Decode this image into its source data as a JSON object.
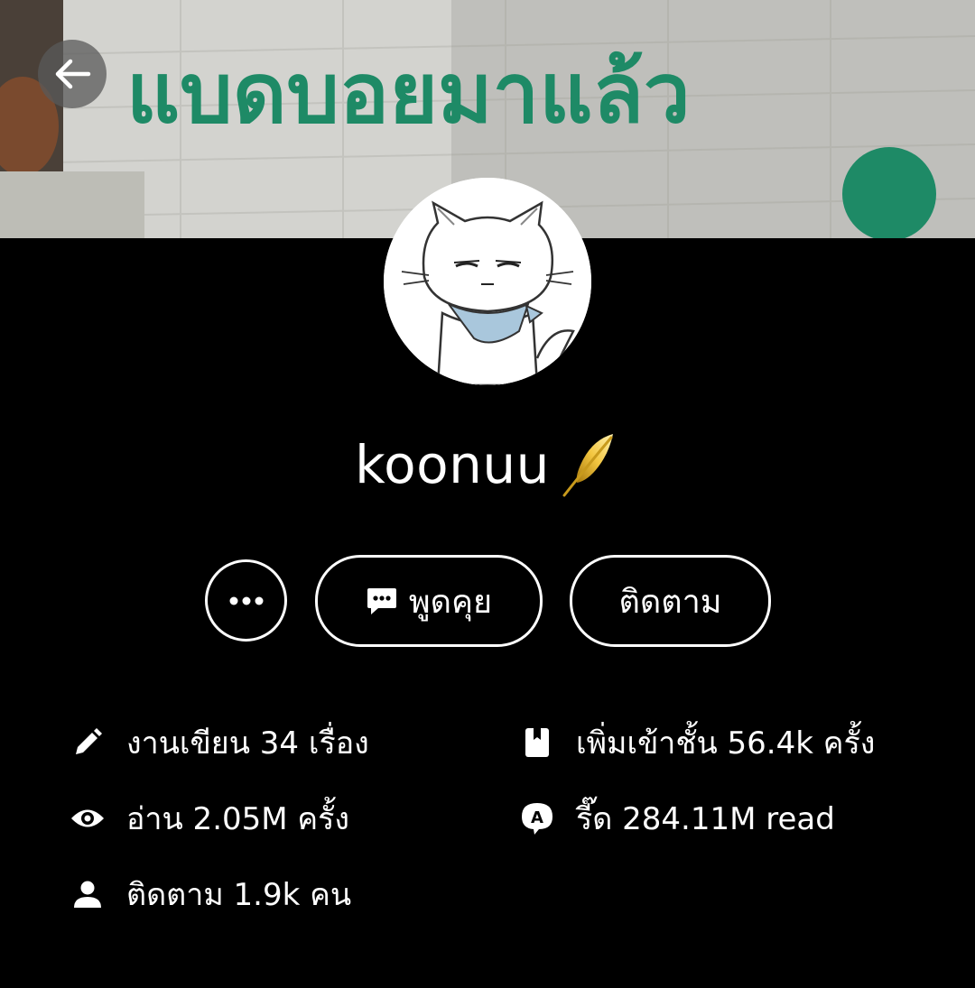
{
  "cover": {
    "graffiti_text": "แบดบอยมาแล้ว"
  },
  "profile": {
    "name": "koonuu",
    "badge_icon": "golden-feather-icon"
  },
  "actions": {
    "more_icon": "more-dots-icon",
    "chat_label": "พูดคุย",
    "chat_icon": "chat-bubble-icon",
    "follow_label": "ติดตาม"
  },
  "stats": {
    "works": {
      "icon": "pencil-icon",
      "text": "งานเขียน 34 เรื่อง"
    },
    "library": {
      "icon": "bookmark-icon",
      "text": "เพิ่มเข้าชั้น 56.4k ครั้ง"
    },
    "reads": {
      "icon": "eye-icon",
      "text": "อ่าน 2.05M ครั้ง"
    },
    "reeds": {
      "icon": "chat-a-icon",
      "text": "รี๊ด 284.11M read"
    },
    "followers": {
      "icon": "person-icon",
      "text": "ติดตาม 1.9k คน"
    }
  },
  "colors": {
    "background": "#000000",
    "foreground": "#ffffff",
    "graffiti": "#1e8a66",
    "feather_gold": "#d4a017"
  }
}
